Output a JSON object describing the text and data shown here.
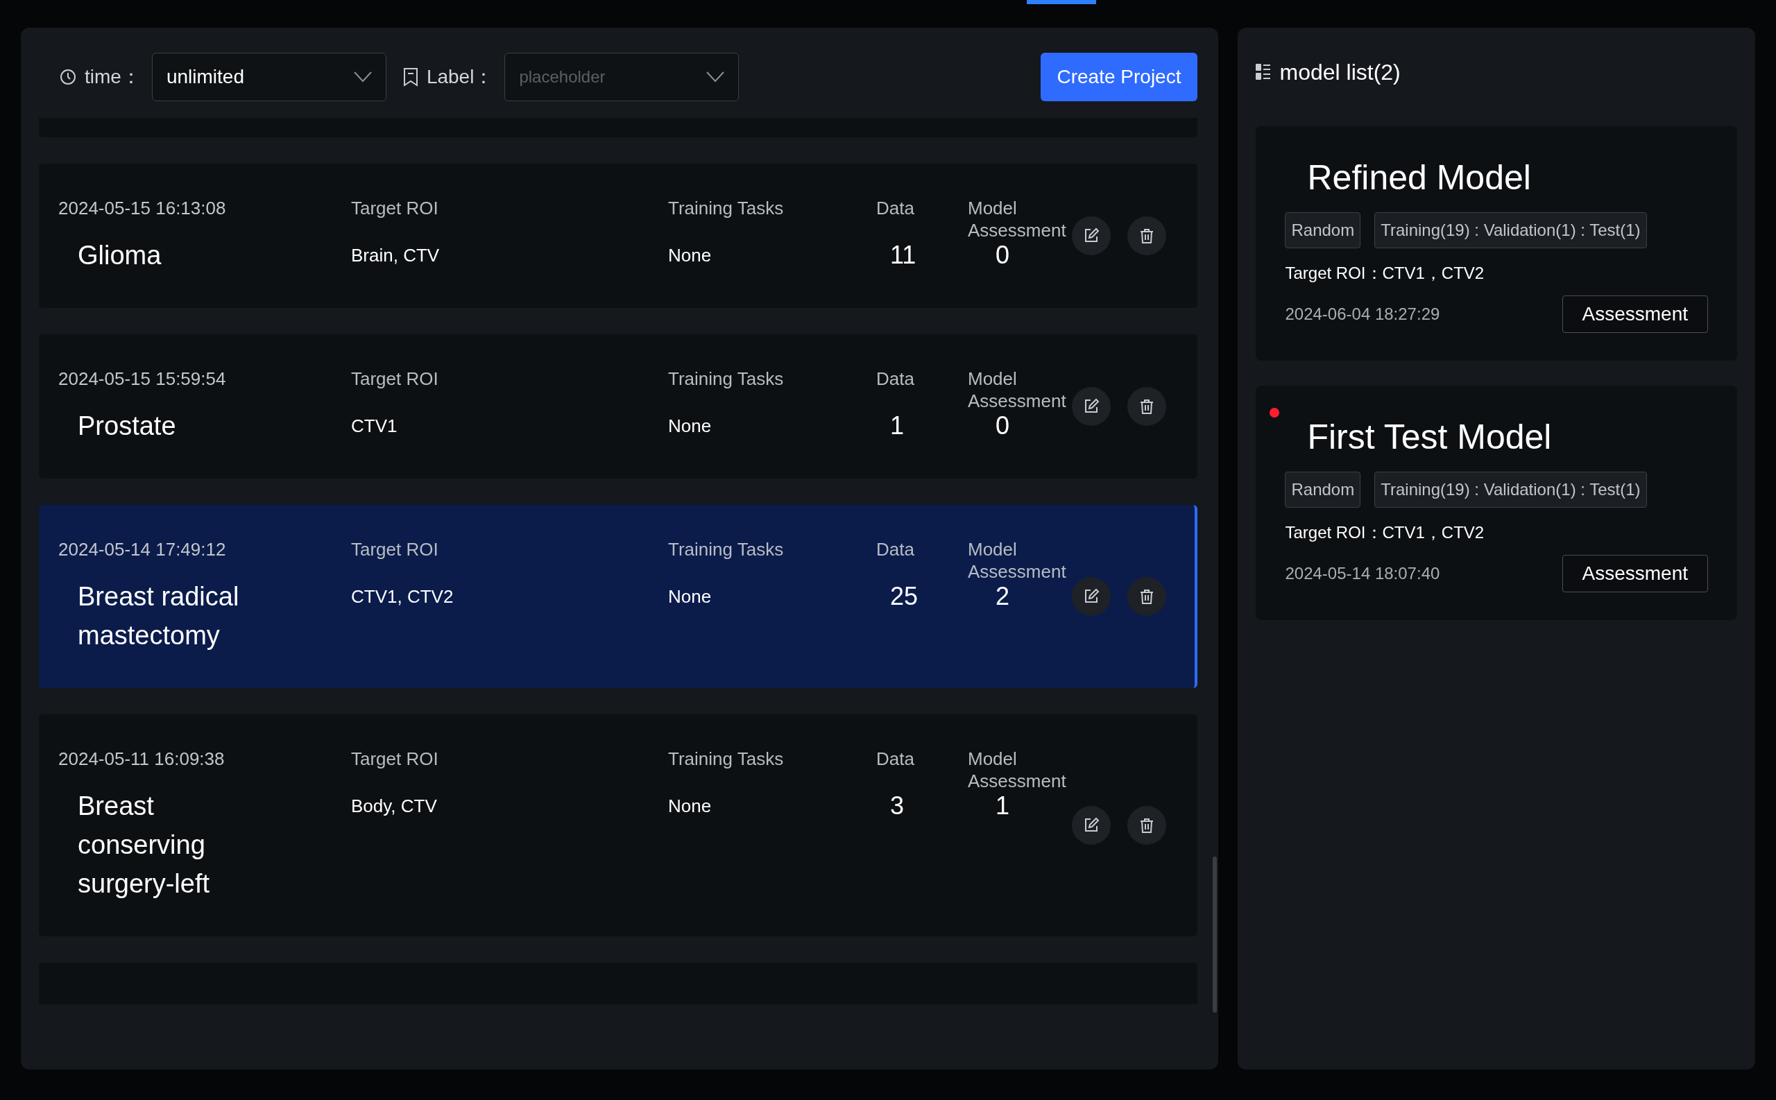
{
  "filters": {
    "time": {
      "label": "time：",
      "value": "unlimited"
    },
    "label": {
      "label": "Label：",
      "placeholder": "placeholder"
    }
  },
  "create_button": "Create Project",
  "projects": [
    {
      "date": "2024-05-15 16:13:08",
      "name": "Glioma",
      "selected": false,
      "target_roi": {
        "label": "Target ROI",
        "value": "Brain, CTV"
      },
      "training_tasks": {
        "label": "Training Tasks",
        "value": "None"
      },
      "data": {
        "label": "Data",
        "value": "11"
      },
      "model_assessment": {
        "label": "Model Assessment",
        "value": "0"
      }
    },
    {
      "date": "2024-05-15 15:59:54",
      "name": "Prostate",
      "selected": false,
      "target_roi": {
        "label": "Target ROI",
        "value": "CTV1"
      },
      "training_tasks": {
        "label": "Training Tasks",
        "value": "None"
      },
      "data": {
        "label": "Data",
        "value": "1"
      },
      "model_assessment": {
        "label": "Model Assessment",
        "value": "0"
      }
    },
    {
      "date": "2024-05-14 17:49:12",
      "name": "Breast radical mastectomy",
      "selected": true,
      "target_roi": {
        "label": "Target ROI",
        "value": "CTV1, CTV2"
      },
      "training_tasks": {
        "label": "Training Tasks",
        "value": "None"
      },
      "data": {
        "label": "Data",
        "value": "25"
      },
      "model_assessment": {
        "label": "Model Assessment",
        "value": "2"
      }
    },
    {
      "date": "2024-05-11 16:09:38",
      "name": "Breast conserving surgery-left",
      "selected": false,
      "target_roi": {
        "label": "Target ROI",
        "value": "Body, CTV"
      },
      "training_tasks": {
        "label": "Training Tasks",
        "value": "None"
      },
      "data": {
        "label": "Data",
        "value": "3"
      },
      "model_assessment": {
        "label": "Model Assessment",
        "value": "1"
      }
    }
  ],
  "model_list": {
    "title": "model list(2)",
    "models": [
      {
        "name": "Refined Model",
        "marked": false,
        "tags": [
          "Random",
          "Training(19) : Validation(1) : Test(1)"
        ],
        "target_roi": "Target ROI：CTV1，CTV2",
        "date": "2024-06-04 18:27:29",
        "button": "Assessment"
      },
      {
        "name": "First Test Model",
        "marked": true,
        "tags": [
          "Random",
          "Training(19) : Validation(1) : Test(1)"
        ],
        "target_roi": "Target ROI：CTV1，CTV2",
        "date": "2024-05-14 18:07:40",
        "button": "Assessment"
      }
    ]
  }
}
